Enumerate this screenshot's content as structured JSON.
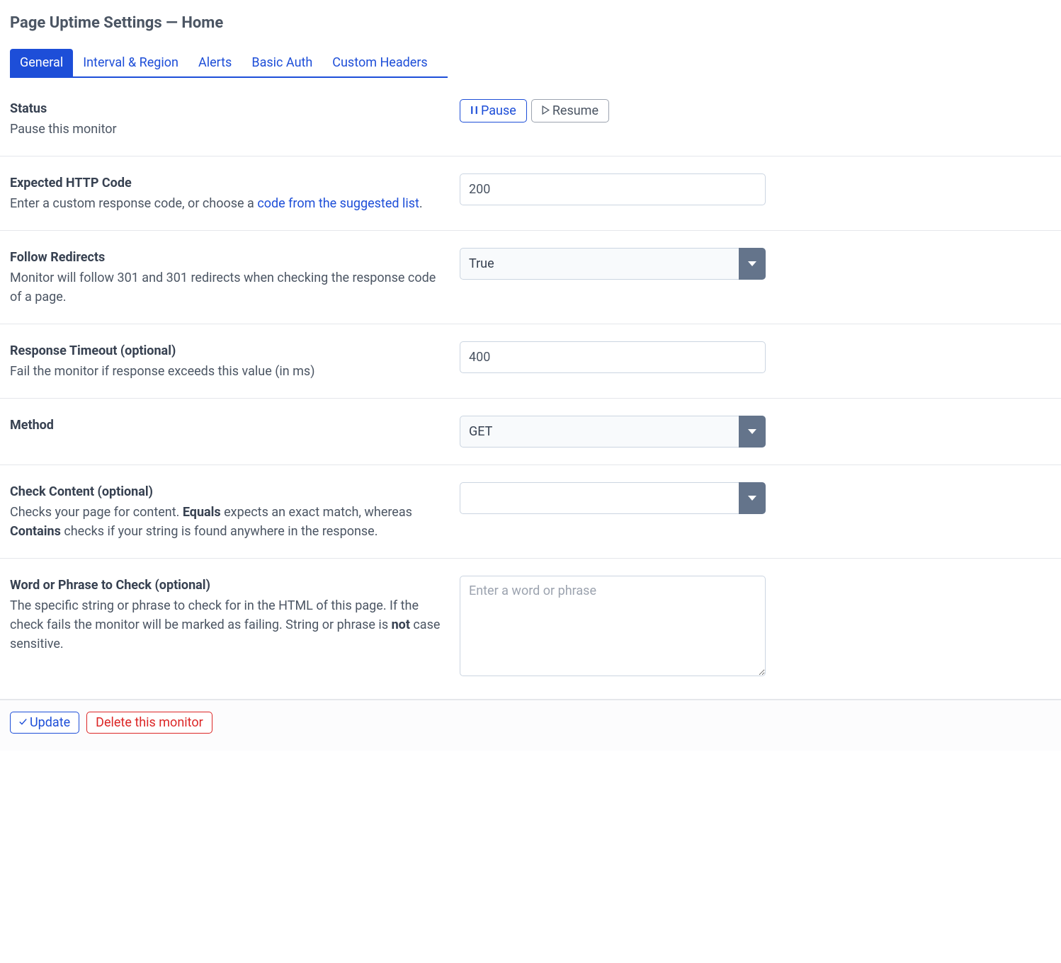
{
  "page": {
    "title": "Page Uptime Settings — Home"
  },
  "tabs": [
    {
      "label": "General",
      "active": true
    },
    {
      "label": "Interval & Region",
      "active": false
    },
    {
      "label": "Alerts",
      "active": false
    },
    {
      "label": "Basic Auth",
      "active": false
    },
    {
      "label": "Custom Headers",
      "active": false
    }
  ],
  "fields": {
    "status": {
      "label": "Status",
      "help": "Pause this monitor",
      "pause_label": "Pause",
      "resume_label": "Resume"
    },
    "expected_code": {
      "label": "Expected HTTP Code",
      "help_prefix": "Enter a custom response code, or choose a ",
      "help_link": "code from the suggested list",
      "help_suffix": ".",
      "value": "200"
    },
    "follow_redirects": {
      "label": "Follow Redirects",
      "help": "Monitor will follow 301 and 301 redirects when checking the response code of a page.",
      "value": "True"
    },
    "response_timeout": {
      "label": "Response Timeout (optional)",
      "help": "Fail the monitor if response exceeds this value (in ms)",
      "value": "400"
    },
    "method": {
      "label": "Method",
      "value": "GET"
    },
    "check_content": {
      "label": "Check Content (optional)",
      "help_p1": "Checks your page for content. ",
      "help_b1": "Equals",
      "help_p2": " expects an exact match, whereas ",
      "help_b2": "Contains",
      "help_p3": " checks if your string is found anywhere in the response.",
      "value": ""
    },
    "word_phrase": {
      "label": "Word or Phrase to Check (optional)",
      "help_p1": "The specific string or phrase to check for in the HTML of this page. If the check fails the monitor will be marked as failing. String or phrase is ",
      "help_b1": "not",
      "help_p2": " case sensitive.",
      "placeholder": "Enter a word or phrase",
      "value": ""
    }
  },
  "footer": {
    "update_label": "Update",
    "delete_label": "Delete this monitor"
  }
}
